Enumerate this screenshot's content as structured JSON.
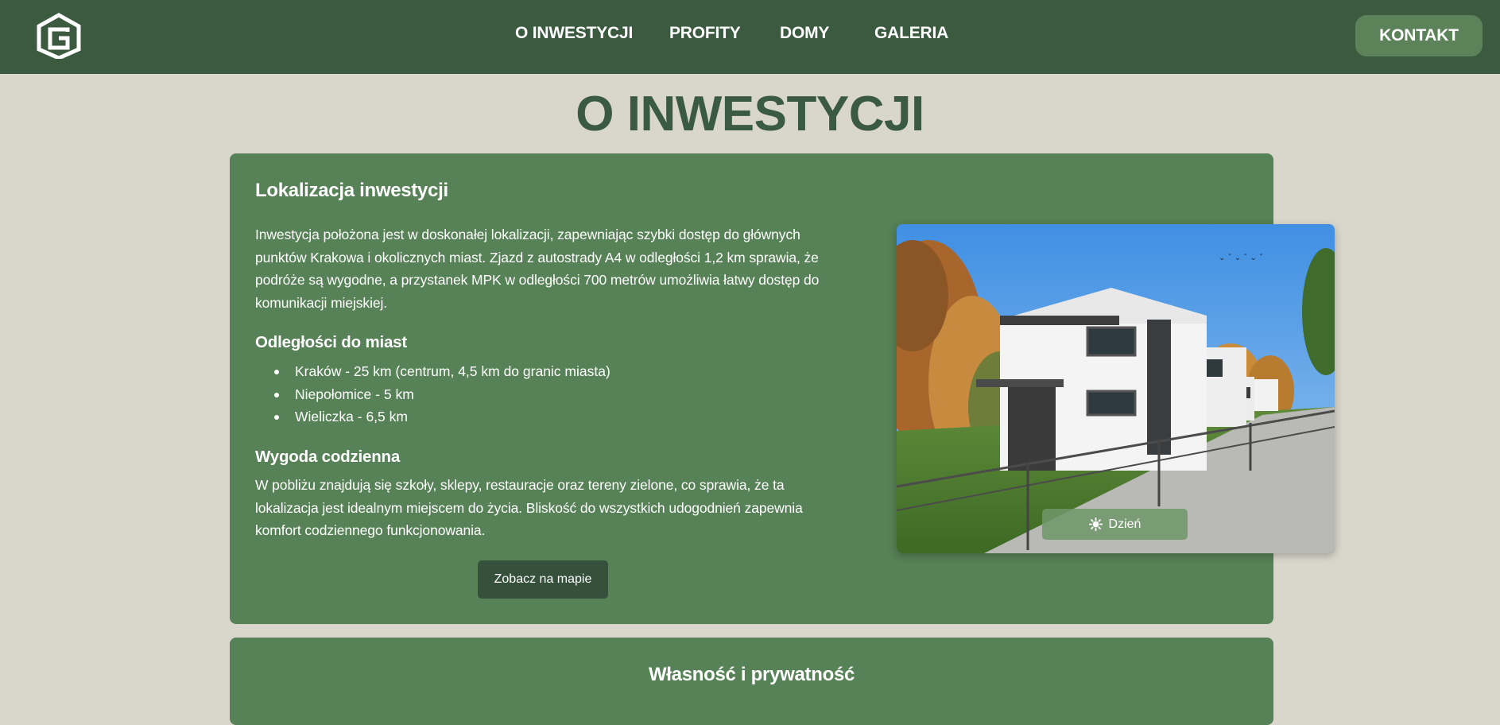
{
  "nav": {
    "logo_icon": "g-house-logo-icon",
    "links": [
      "O INWESTYCJI",
      "PROFITY",
      "DOMY",
      "GALERIA"
    ],
    "contact_label": "KONTAKT"
  },
  "page": {
    "title": "O INWESTYCJI"
  },
  "location": {
    "heading": "Lokalizacja inwestycji",
    "intro": "Inwestycja położona jest w doskonałej lokalizacji, zapewniając szybki dostęp do głównych punktów Krakowa i okolicznych miast. Zjazd z autostrady A4 w odległości 1,2 km sprawia, że podróże są wygodne, a przystanek MPK w odległości 700 metrów umożliwia łatwy dostęp do komunikacji miejskiej.",
    "distances_heading": "Odległości do miast",
    "distances": [
      "Kraków - 25 km (centrum, 4,5 km do granic miasta)",
      "Niepołomice - 5 km",
      "Wieliczka - 6,5 km"
    ],
    "comfort_heading": "Wygoda codzienna",
    "comfort_text": "W pobliżu znajdują się szkoły, sklepy, restauracje oraz tereny zielone, co sprawia, że ta lokalizacja jest idealnym miejscem do życia. Bliskość do wszystkich udogodnień zapewnia komfort codziennego funkcjonowania.",
    "map_button": "Zobacz na mapie",
    "photo_toggle": {
      "icon": "sun-icon",
      "label": "Dzień"
    }
  },
  "ownership": {
    "heading": "Własność i prywatność"
  },
  "colors": {
    "header_bg": "#3c5a40",
    "page_bg": "#d9d6cb",
    "card_bg": "#578156",
    "title_color": "#3b5a44",
    "button_dark": "#35503b"
  }
}
